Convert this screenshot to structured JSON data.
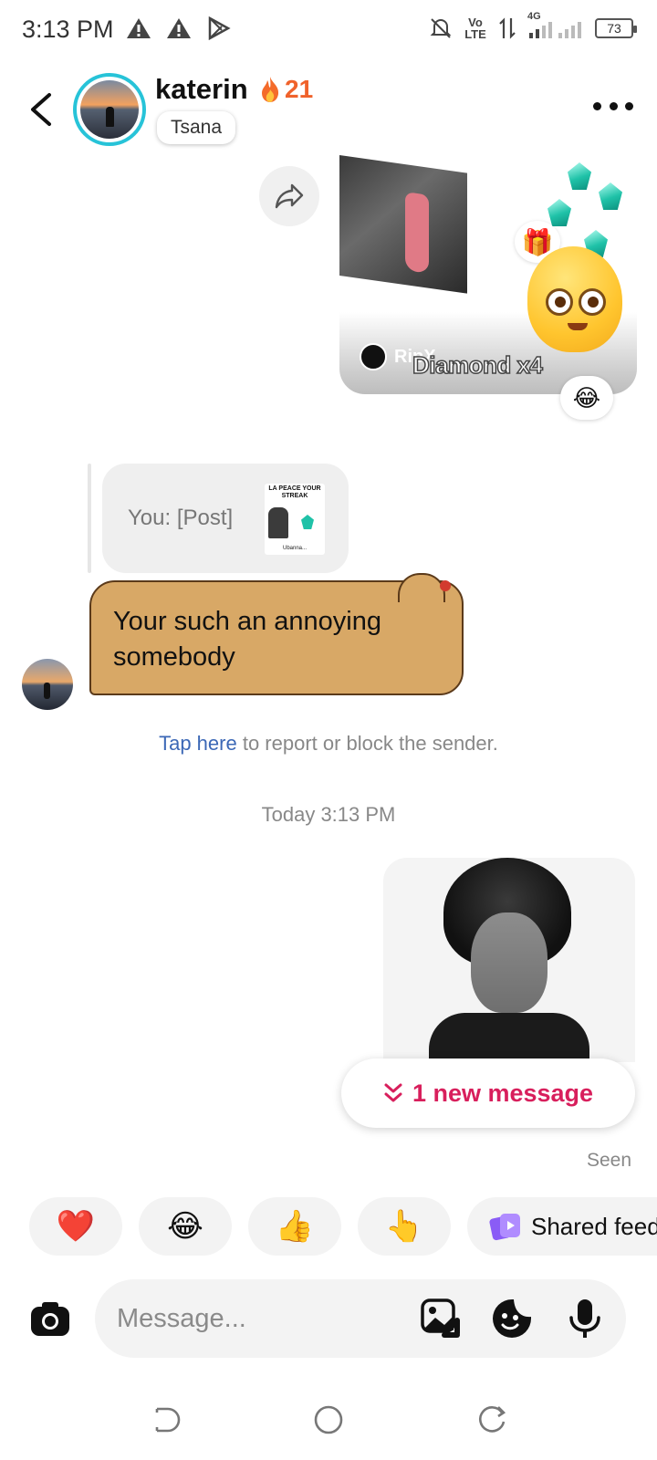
{
  "status_bar": {
    "time": "3:13 PM",
    "network_label": "Vo LTE",
    "signal_label": "4G",
    "battery": "73"
  },
  "header": {
    "name": "katerin",
    "streak": "21",
    "username": "Tsana"
  },
  "chat": {
    "shared_post": {
      "author": "RipX",
      "caption": "Diamond x4",
      "reaction": "😂"
    },
    "reply_quote": {
      "text": "You: [Post]",
      "thumb_title": "LA PEACE YOUR STREAK",
      "thumb_footer": "Ubanna..."
    },
    "received_message": "Your such an annoying somebody",
    "report": {
      "link": "Tap here",
      "text": " to report or block the sender."
    },
    "timestamp": "Today 3:13 PM",
    "new_message_pill": "1 new message",
    "seen": "Seen"
  },
  "quick_reactions": {
    "items": [
      "❤️",
      "😂",
      "👍",
      "👆"
    ],
    "shared_feed": "Shared feed"
  },
  "composer": {
    "placeholder": "Message..."
  },
  "colors": {
    "accent_pink": "#d81f5c",
    "link_blue": "#3c68b6",
    "streak_orange": "#f0622b",
    "bubble_theme": "#d8a866"
  }
}
